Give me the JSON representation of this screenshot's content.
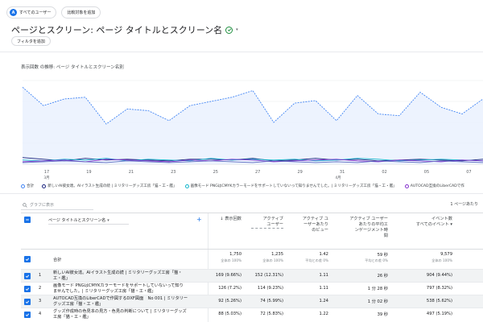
{
  "chips": {
    "all_users_badge": "A",
    "all_users": "すべてのユーザー",
    "add_compare": "比較対象を追加"
  },
  "title": "ページとスクリーン: ページ タイトルとスクリーン名",
  "filter_label": "フィルタを追加",
  "chart_title": "表示回数 の推移: ページ タイトルとスクリーン名別",
  "colors": {
    "total": "#4285f4",
    "s1": "#1a237e",
    "s2": "#12b5cb",
    "s3": "#8430ce",
    "s4": "#5c6bc0"
  },
  "chart_data": {
    "type": "line",
    "x": [
      "17",
      "18",
      "19",
      "20",
      "21",
      "22",
      "23",
      "24",
      "25",
      "26",
      "27",
      "28",
      "29",
      "30",
      "31",
      "1",
      "2",
      "3",
      "4",
      "5",
      "6",
      "7",
      "8"
    ],
    "xlabels_shown": [
      "17",
      "19",
      "21",
      "23",
      "25",
      "27",
      "29",
      "31",
      "02",
      "05",
      "07"
    ],
    "x_month_label": "3月",
    "x_month2_label": "4月",
    "series": [
      {
        "name": "合計",
        "values": [
          92,
          70,
          78,
          80,
          48,
          66,
          64,
          52,
          70,
          75,
          80,
          88,
          50,
          73,
          76,
          52,
          82,
          60,
          58,
          86,
          68,
          60,
          78
        ]
      },
      {
        "name": "新しいAI彼女達。AIイラスト生成の続 | ミリタリーグッズ工房「猫・工・艦」",
        "values": [
          8,
          6,
          4,
          7,
          5,
          6,
          5,
          4,
          6,
          6,
          5,
          7,
          4,
          5,
          7,
          5,
          6,
          4,
          5,
          6,
          5,
          4,
          6
        ]
      },
      {
        "name": "画像モード PNGはCMYKカラーモードをサポートしていないって知りませんでした。| ミリタリーグッズ工房「猫・工・艦」",
        "values": [
          5,
          4,
          6,
          5,
          7,
          4,
          6,
          5,
          4,
          7,
          5,
          6,
          5,
          6,
          4,
          5,
          7,
          6,
          4,
          5,
          6,
          5,
          4
        ]
      },
      {
        "name": "AUTOCAD互換のLiberCADで作図するDXF図面",
        "values": [
          3,
          4,
          5,
          3,
          6,
          5,
          4,
          3,
          5,
          4,
          6,
          5,
          3,
          4,
          5,
          6,
          4,
          3,
          5,
          4,
          3,
          5,
          4
        ]
      },
      {
        "name": "グッズ作成時の色見本の見方",
        "values": [
          2,
          3,
          4,
          3,
          2,
          4,
          3,
          2,
          3,
          4,
          3,
          2,
          4,
          3,
          2,
          3,
          2,
          4,
          3,
          2,
          4,
          3,
          2
        ]
      }
    ],
    "grid": true
  },
  "legend": [
    "合計",
    "新しいAI彼女達。AIイラスト生成の続 | ミリタリーグッズ工房「猫・工・艦」",
    "画像モード PNGはCMYKカラーモードをサポートしていないって知りませんでした。| ミリタリーグッズ工房「猫・工・艦」",
    "AUTOCAD互換のLiberCADで作"
  ],
  "table": {
    "search_placeholder": "グラフに表示",
    "pager": "1 ページあたり",
    "dimension": "ページ タイトルとスクリーン名",
    "headers": {
      "views": "↓ 表示回数",
      "active_users_1": "アクティブ",
      "active_users_2": "ユーザー",
      "views_per_user_1": "アクティブ ユ",
      "views_per_user_2": "ーザーあたり",
      "views_per_user_3": "のビュー",
      "engagement_1": "アクティブ ユーザー",
      "engagement_2": "あたりの平均エ",
      "engagement_3": "ンゲージメント時",
      "engagement_4": "間",
      "events_1": "イベント数",
      "events_2": "すべてのイベント ▾"
    },
    "total_label": "合計",
    "totals": {
      "views": "1,750",
      "views_sub": "全体の 100%",
      "users": "1,235",
      "users_sub": "全体の 100%",
      "per_user": "1.42",
      "per_user_sub": "平均との差 0%",
      "engagement": "59 秒",
      "engagement_sub": "平均との差 0%",
      "events": "9,579",
      "events_sub": "全体の 100%"
    },
    "rows": [
      {
        "num": "1",
        "title_1": "新しいAI彼女達。AIイラスト生成の続 | ミリタリーグッズ工房「猫・",
        "title_2": "工・艦」",
        "views": "169 (9.66%)",
        "users": "152 (12.31%)",
        "per_user": "1.11",
        "engagement": "26 秒",
        "events": "904 (9.44%)"
      },
      {
        "num": "2",
        "title_1": "画像モード PNGはCMYKカラーモードをサポートしていないって知り",
        "title_2": "ませんでした。| ミリタリーグッズ工房「猫・工・艦」",
        "views": "126 (7.2%)",
        "users": "114 (9.23%)",
        "per_user": "1.11",
        "engagement": "1 分 28 秒",
        "events": "797 (8.32%)"
      },
      {
        "num": "3",
        "title_1": "AUTOCAD互換のLiberCADで作図するDXF図面　No 001 | ミリタリー",
        "title_2": "グッズ工房「猫・工・艦」",
        "views": "92 (5.26%)",
        "users": "74 (5.99%)",
        "per_user": "1.24",
        "engagement": "1 分 02 秒",
        "events": "538 (5.62%)"
      },
      {
        "num": "4",
        "title_1": "グッズ作成時の色見本の見方・色見の判断について | ミリタリーグッズ",
        "title_2": "工房「猫・工・艦」",
        "views": "88 (5.03%)",
        "users": "72 (5.83%)",
        "per_user": "1.22",
        "engagement": "39 秒",
        "events": "497 (5.19%)"
      }
    ]
  }
}
